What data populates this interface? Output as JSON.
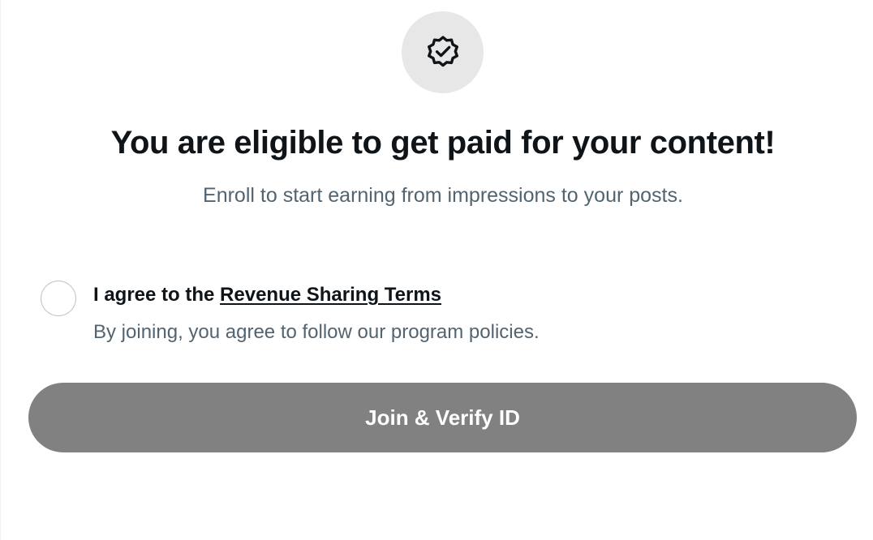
{
  "header": {
    "icon": "verified-badge-icon",
    "title": "You are eligible to get paid for your content!",
    "subtitle": "Enroll to start earning from impressions to your posts."
  },
  "agreement": {
    "checked": false,
    "prefix": "I agree to the",
    "link_label": "Revenue Sharing Terms",
    "note": "By joining, you agree to follow our program policies."
  },
  "actions": {
    "join_label": "Join & Verify ID",
    "join_enabled": false
  },
  "colors": {
    "primary_text": "#0f1419",
    "secondary_text": "#536471",
    "disabled_button": "#818181",
    "badge_background": "#e7e7e7"
  }
}
